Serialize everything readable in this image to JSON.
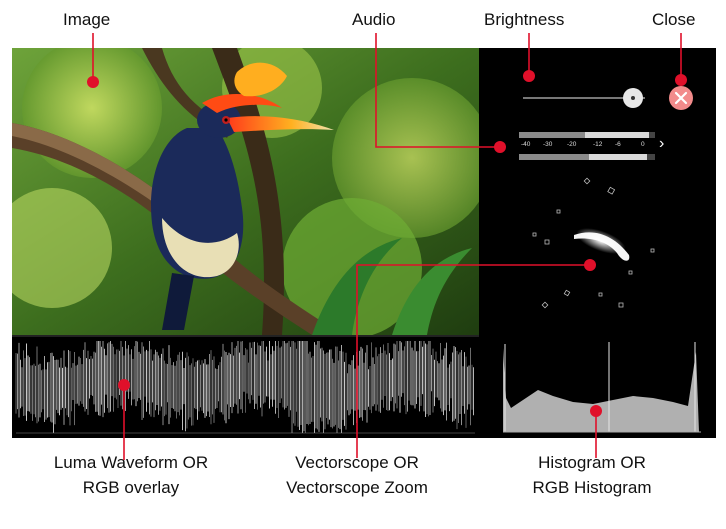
{
  "labels": {
    "image": "Image",
    "audio": "Audio",
    "brightness": "Brightness",
    "close": "Close",
    "luma_line1": "Luma Waveform OR",
    "luma_line2": "RGB overlay",
    "vector_line1": "Vectorscope OR",
    "vector_line2": "Vectorscope Zoom",
    "histo_line1": "Histogram OR",
    "histo_line2": "RGB Histogram"
  },
  "audio_meter": {
    "scale": [
      "-40",
      "-30",
      "-20",
      "-12",
      "-6",
      "0"
    ],
    "expand_glyph": "›"
  },
  "brightness_level": 0.9,
  "icons": {
    "close": "close-icon",
    "expand": "chevron-right-icon"
  },
  "colors": {
    "callout": "#e0102a",
    "close_button": "#f28b8b",
    "panel": "#000000"
  }
}
